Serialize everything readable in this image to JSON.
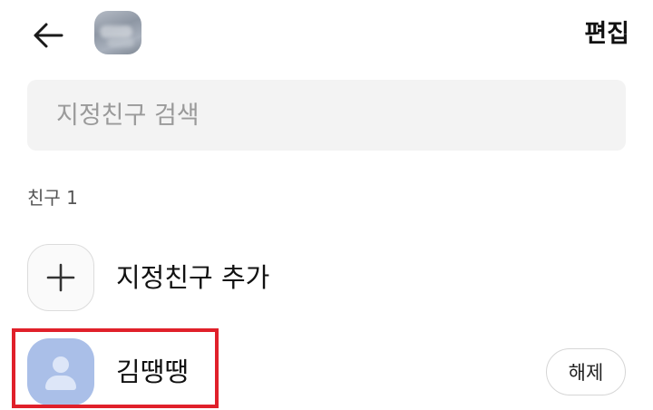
{
  "header": {
    "back_icon": "arrow-left-icon",
    "edit_label": "편집"
  },
  "search": {
    "placeholder": "지정친구 검색",
    "value": ""
  },
  "section": {
    "label": "친구 1"
  },
  "add_friend": {
    "icon": "plus-icon",
    "label": "지정친구 추가"
  },
  "friends": [
    {
      "name": "김땡땡",
      "avatar_icon": "default-person-icon",
      "action_label": "해제"
    }
  ],
  "colors": {
    "highlight": "#e0202a",
    "avatar_bg": "#aabfe8",
    "search_bg": "#f3f3f3"
  }
}
